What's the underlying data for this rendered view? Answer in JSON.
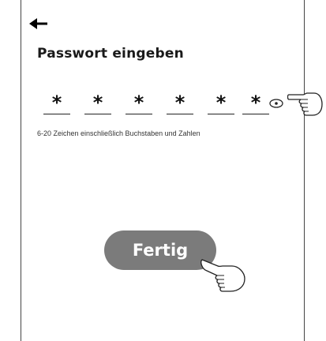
{
  "header": {
    "back_icon": "arrow-left-icon"
  },
  "page": {
    "title": "Passwort eingeben"
  },
  "password": {
    "slots": [
      "*",
      "*",
      "*",
      "*",
      "*",
      "*"
    ],
    "toggle_icon": "eye-icon"
  },
  "hint": {
    "text": "6-20 Zeichen einschließlich Buchstaben und Zahlen"
  },
  "actions": {
    "done_label": "Fertig"
  },
  "colors": {
    "button_bg": "#7b7b7b",
    "button_text": "#ffffff",
    "text": "#1a1a1a"
  }
}
